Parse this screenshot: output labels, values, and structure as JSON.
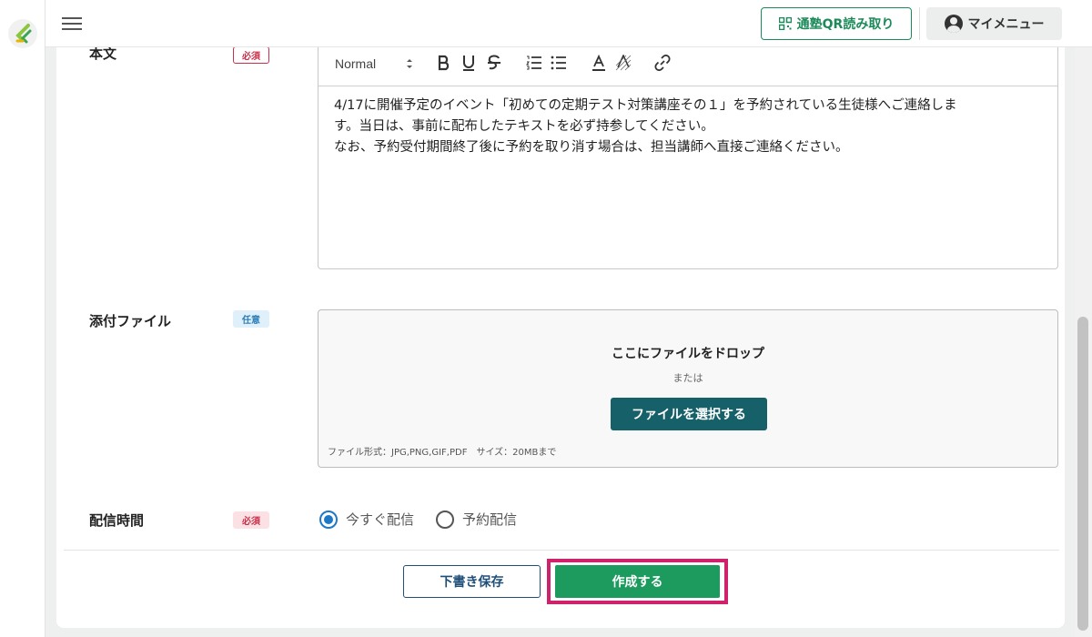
{
  "header": {
    "qr_button_label": "通塾QR読み取り",
    "my_menu_label": "マイメニュー"
  },
  "fields": {
    "body": {
      "label": "本文",
      "badge": "必須",
      "toolbar": {
        "format_select": "Normal"
      },
      "text_lines": [
        "4/17に開催予定のイベント「初めての定期テスト対策講座その１」を予約されている生徒様へご連絡しま",
        "す。当日は、事前に配布したテキストを必ず持参してください。",
        "なお、予約受付期間終了後に予約を取り消す場合は、担当講師へ直接ご連絡ください。"
      ]
    },
    "attachment": {
      "label": "添付ファイル",
      "badge": "任意",
      "drop_text": "ここにファイルをドロップ",
      "or_text": "または",
      "select_button": "ファイルを選択する",
      "note": "ファイル形式：JPG,PNG,GIF,PDF　サイズ：20MBまで"
    },
    "delivery_time": {
      "label": "配信時間",
      "badge": "必須",
      "options": [
        "今すぐ配信",
        "予約配信"
      ],
      "selected": "今すぐ配信"
    }
  },
  "actions": {
    "draft_label": "下書き保存",
    "create_label": "作成する"
  },
  "colors": {
    "brand_green": "#1d9a5d",
    "dark_teal": "#16606a",
    "highlight": "#d0226a",
    "required_red": "#c9304b",
    "optional_blue": "#2e7fb8",
    "radio_blue": "#1e78c8"
  }
}
